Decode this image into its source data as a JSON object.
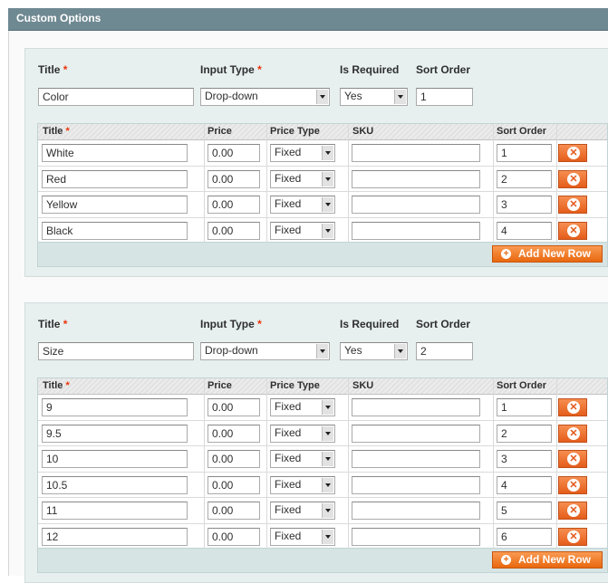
{
  "header": {
    "title": "Custom Options"
  },
  "labels": {
    "title": "Title",
    "required_mark": "*",
    "input_type": "Input Type",
    "is_required": "Is Required",
    "sort_order": "Sort Order"
  },
  "columns": {
    "title": "Title",
    "price": "Price",
    "price_type": "Price Type",
    "sku": "SKU",
    "sort_order": "Sort Order"
  },
  "add_row_label": "Add New Row",
  "icons": {
    "delete": "close-circle-icon",
    "add": "plus-circle-icon",
    "dropdown": "chevron-down-icon"
  },
  "colors": {
    "header_bg": "#6f8992",
    "button_orange": "#e8680f",
    "required_red": "#eb340a"
  },
  "options": [
    {
      "title": "Color",
      "input_type": "Drop-down",
      "is_required": "Yes",
      "sort_order": "1",
      "rows": [
        {
          "title": "White",
          "price": "0.00",
          "price_type": "Fixed",
          "sku": "",
          "sort_order": "1"
        },
        {
          "title": "Red",
          "price": "0.00",
          "price_type": "Fixed",
          "sku": "",
          "sort_order": "2"
        },
        {
          "title": "Yellow",
          "price": "0.00",
          "price_type": "Fixed",
          "sku": "",
          "sort_order": "3"
        },
        {
          "title": "Black",
          "price": "0.00",
          "price_type": "Fixed",
          "sku": "",
          "sort_order": "4"
        }
      ]
    },
    {
      "title": "Size",
      "input_type": "Drop-down",
      "is_required": "Yes",
      "sort_order": "2",
      "rows": [
        {
          "title": "9",
          "price": "0.00",
          "price_type": "Fixed",
          "sku": "",
          "sort_order": "1"
        },
        {
          "title": "9.5",
          "price": "0.00",
          "price_type": "Fixed",
          "sku": "",
          "sort_order": "2"
        },
        {
          "title": "10",
          "price": "0.00",
          "price_type": "Fixed",
          "sku": "",
          "sort_order": "3"
        },
        {
          "title": "10.5",
          "price": "0.00",
          "price_type": "Fixed",
          "sku": "",
          "sort_order": "4"
        },
        {
          "title": "11",
          "price": "0.00",
          "price_type": "Fixed",
          "sku": "",
          "sort_order": "5"
        },
        {
          "title": "12",
          "price": "0.00",
          "price_type": "Fixed",
          "sku": "",
          "sort_order": "6"
        }
      ]
    }
  ]
}
